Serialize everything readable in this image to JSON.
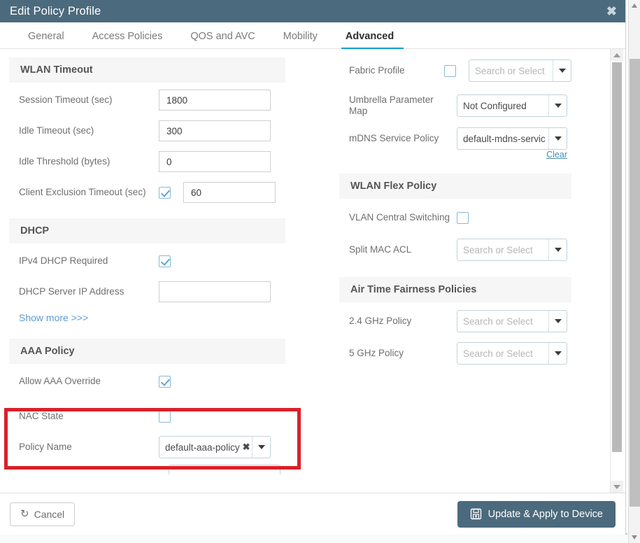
{
  "window": {
    "title": "Edit Policy Profile",
    "close_icon": "close-icon",
    "titlebar_color": "#4c6a7d"
  },
  "tabs": [
    {
      "label": "General",
      "active": false
    },
    {
      "label": "Access Policies",
      "active": false
    },
    {
      "label": "QOS and AVC",
      "active": false
    },
    {
      "label": "Mobility",
      "active": false
    },
    {
      "label": "Advanced",
      "active": true
    }
  ],
  "accent_color": "#00a0d1",
  "highlight": {
    "name": "aaa-policy-highlight",
    "color": "#d9202a"
  },
  "left_column": {
    "wlan_timeout": {
      "header": "WLAN Timeout",
      "session_timeout_label": "Session Timeout (sec)",
      "session_timeout_value": "1800",
      "idle_timeout_label": "Idle Timeout (sec)",
      "idle_timeout_value": "300",
      "idle_threshold_label": "Idle Threshold (bytes)",
      "idle_threshold_value": "0",
      "client_exclusion_label": "Client Exclusion Timeout (sec)",
      "client_exclusion_checked": true,
      "client_exclusion_value": "60"
    },
    "dhcp": {
      "header": "DHCP",
      "ipv4_required_label": "IPv4 DHCP Required",
      "ipv4_required_checked": true,
      "server_ip_label": "DHCP Server IP Address",
      "server_ip_value": ""
    },
    "show_more_label": "Show more >>>",
    "aaa_policy": {
      "header": "AAA Policy",
      "allow_override_label": "Allow AAA Override",
      "allow_override_checked": true,
      "nac_state_label": "NAC State",
      "nac_state_checked": false,
      "policy_name_label": "Policy Name",
      "policy_name_value": "default-aaa-policy",
      "policy_name_clear_icon": "clear-chip-icon"
    }
  },
  "right_column": {
    "fabric_profile": {
      "label": "Fabric Profile",
      "checked": false,
      "value": "",
      "placeholder": "Search or Select"
    },
    "umbrella_parameter_map": {
      "label": "Umbrella Parameter Map",
      "value": "Not Configured"
    },
    "mdns_service_policy": {
      "label": "mDNS Service Policy",
      "value": "default-mdns-servic",
      "clear_label": "Clear"
    },
    "wlan_flex_policy": {
      "header": "WLAN Flex Policy",
      "vlan_central_switching_label": "VLAN Central Switching",
      "vlan_central_switching_checked": false,
      "split_mac_acl_label": "Split MAC ACL",
      "split_mac_acl_value": "",
      "split_mac_acl_placeholder": "Search or Select"
    },
    "air_time_fairness": {
      "header": "Air Time Fairness Policies",
      "policy_24ghz_label": "2.4 GHz Policy",
      "policy_24ghz_value": "",
      "policy_24ghz_placeholder": "Search or Select",
      "policy_5ghz_label": "5 GHz Policy",
      "policy_5ghz_value": "",
      "policy_5ghz_placeholder": "Search or Select"
    }
  },
  "footer": {
    "cancel_label": "Cancel",
    "cancel_icon": "undo-icon",
    "apply_label": "Update & Apply to Device",
    "apply_icon": "save-floppy-icon"
  },
  "background_page": {
    "partial_text": ""
  }
}
